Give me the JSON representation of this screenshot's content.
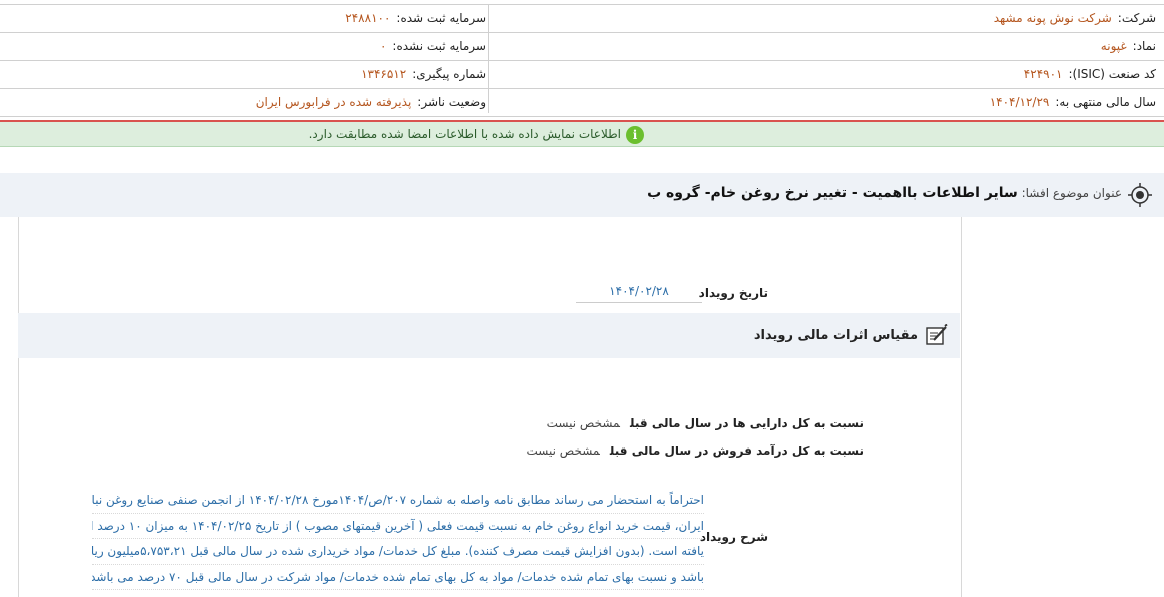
{
  "company_info": {
    "company_label": "شرکت:",
    "company_value": "شرکت نوش پونه مشهد",
    "registered_capital_label": "سرمایه ثبت شده:",
    "registered_capital_value": "۲۴۸۸۱۰۰",
    "symbol_label": "نماد:",
    "symbol_value": "غپونه",
    "unregistered_capital_label": "سرمایه ثبت نشده:",
    "unregistered_capital_value": "۰",
    "isic_label": "کد صنعت (ISIC):",
    "isic_value": "۴۲۴۹۰۱",
    "tracking_label": "شماره پیگیری:",
    "tracking_value": "۱۳۴۶۵۱۲",
    "fiscal_year_label": "سال مالی منتهی به:",
    "fiscal_year_value": "۱۴۰۴/۱۲/۲۹",
    "publisher_status_label": "وضعیت ناشر:",
    "publisher_status_value": "پذیرفته شده در فرابورس ایران"
  },
  "notice": {
    "text": "اطلاعات نمایش داده شده با اطلاعات امضا شده مطابقت دارد.",
    "icon": "info-icon",
    "color": "#6bbf2e"
  },
  "title": {
    "label": "عنوان موضوع افشا:",
    "value": "سایر اطلاعات بااهمیت - تغییر نرخ روغن خام- گروه ب"
  },
  "event": {
    "date_label": "تاریخ رویداد",
    "date_value": "۱۴۰۴/۰۲/۲۸"
  },
  "financial_effects": {
    "section_title": "مقیاس اثرات مالی رویداد",
    "metrics": [
      {
        "label": "نسبت به کل دارایی ها در سال مالی قبل",
        "value": "مشخص نیست"
      },
      {
        "label": "نسبت به کل درآمد فروش در سال مالی قبل",
        "value": "مشخص نیست"
      }
    ]
  },
  "description": {
    "label": "شرح رویداد",
    "lines": [
      "احتراماً به استحضار می رساند مطابق نامه واصله به شماره ۲۰۷/ص/۱۴۰۴مورخ ۱۴۰۴/۰۲/۲۸ از انجمن صنفی صنایع روغن نباتی",
      "ایران، قیمت خرید انواع روغن خام به نسبت قیمت فعلی ( آخرین قیمتهای مصوب ) از تاریخ ۱۴۰۴/۰۲/۲۵ به میزان ۱۰ درصد افزایش",
      "یافته است. (بدون افزایش قیمت مصرف کننده). مبلغ کل خدمات/ مواد خریداری شده در سال مالی قبل ۵،۷۵۳،۲۱میلیون ریال می",
      "باشد و نسبت بهای تمام شده خدمات/ مواد به کل بهای تمام شده خدمات/ مواد شرکت در سال مالی قبل ۷۰ درصد می باشد."
    ]
  }
}
